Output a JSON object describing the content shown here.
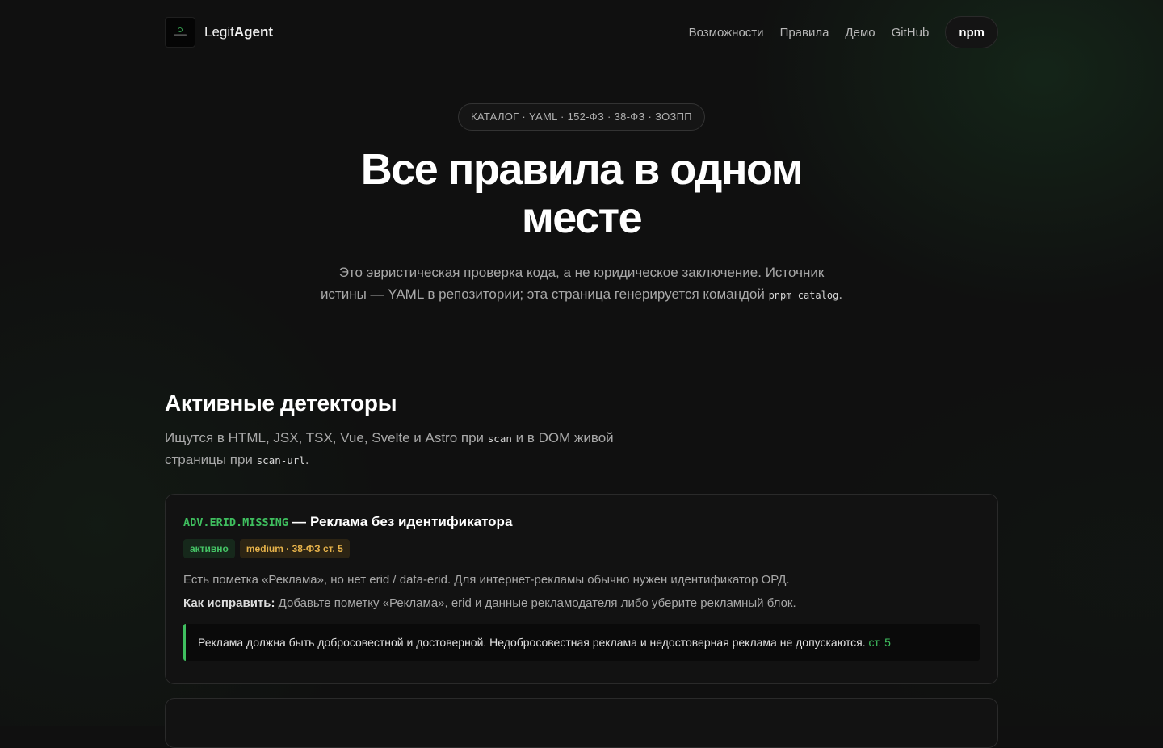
{
  "header": {
    "brand_prefix": "Legit",
    "brand_suffix": "Agent",
    "nav": [
      {
        "label": "Возможности"
      },
      {
        "label": "Правила"
      },
      {
        "label": "Демо"
      },
      {
        "label": "GitHub"
      }
    ],
    "npm_label": "npm"
  },
  "hero": {
    "pill": "КАТАЛОГ · YAML · 152-ФЗ · 38-ФЗ · ЗОЗПП",
    "title": "Все правила в одном месте",
    "subtitle_text": "Это эвристическая проверка кода, а не юридическое заключение. Источник истины — YAML в репозитории; эта страница генерируется командой",
    "subtitle_code": "pnpm catalog",
    "subtitle_end": "."
  },
  "section": {
    "title": "Активные детекторы",
    "desc_part1": "Ищутся в HTML, JSX, TSX, Vue, Svelte и Astro при",
    "desc_code1": "scan",
    "desc_part2": "и в DOM живой страницы при",
    "desc_code2": "scan-url",
    "desc_end": "."
  },
  "rules": [
    {
      "id": "ADV.ERID.MISSING",
      "separator": "—",
      "title": "Реклама без идентификатора",
      "status": "активно",
      "severity": "medium · 38-ФЗ ст. 5",
      "description": "Есть пометка «Реклама», но нет erid / data-erid. Для интернет-рекламы обычно нужен идентификатор ОРД.",
      "fix_label": "Как исправить:",
      "fix_text": "Добавьте пометку «Реклама», erid и данные рекламодателя либо уберите рекламный блок.",
      "quote": "Реклама должна быть добросовестной и достоверной. Недобросовестная реклама и недостоверная реклама не допускаются.",
      "quote_link": "ст. 5"
    }
  ],
  "colors": {
    "accent": "#3fbf5f",
    "background": "#101010",
    "severity": "#e6b24a"
  },
  "icons": {
    "logo": "legitagent-logo-icon"
  }
}
